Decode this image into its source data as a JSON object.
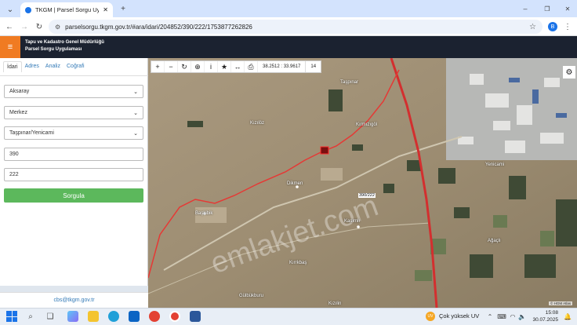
{
  "browser": {
    "tab_title": "TKGM | Parsel Sorgu Uygulaması",
    "url": "parselsorgu.tkgm.gov.tr/#ara/idari/204852/390/222/1753877262826",
    "profile_initial": "B"
  },
  "app": {
    "title_line1": "Tapu ve Kadastro Genel Müdürlüğü",
    "title_line2": "Parsel Sorgu Uygulaması"
  },
  "sidebar": {
    "tabs": [
      {
        "label": "İdari",
        "active": true
      },
      {
        "label": "Adres",
        "active": false
      },
      {
        "label": "Analiz",
        "active": false
      },
      {
        "label": "Coğrafi",
        "active": false
      }
    ],
    "province": "Aksaray",
    "district": "Merkez",
    "neighborhood": "Taşpınar/Yenicami",
    "block": "390",
    "parcel": "222",
    "query_button": "Sorgula",
    "email": "cbs@tkgm.gov.tr"
  },
  "map": {
    "coordinates": "38.2512 : 33.9617",
    "zoom": "14",
    "parcel_label": "390/222",
    "attribution": "© HGM Atlas",
    "watermark": "emlakjet.com",
    "place_labels": [
      "Dikmen",
      "Başkibik",
      "Kasımlı",
      "Kızılin",
      "Gülbükburu",
      "Kırrkbaş",
      "Yenicami",
      "Ağaçlı",
      "Taşpınar",
      "Kızılöz",
      "Kırmızıgöl"
    ]
  },
  "taskbar": {
    "weather": "Çok yüksek UV",
    "weather_badge": "UV",
    "time": "15:08",
    "date": "30.07.2025"
  },
  "colors": {
    "header_bg": "#1b2230",
    "menu_orange": "#f07b22",
    "sorgula_green": "#5cb85c",
    "boundary_red": "#e53935",
    "highway_red": "#d32f2f"
  }
}
